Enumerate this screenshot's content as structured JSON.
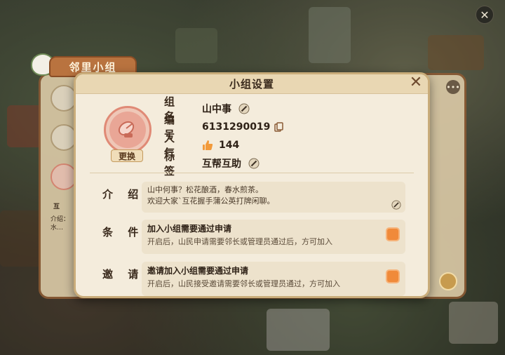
{
  "background_panel": {
    "tab_title": "邻里小组",
    "list_snippet_prefix": "介绍：",
    "list_snippet_prefix2": "水…",
    "list_snippet_tag": "互"
  },
  "modal": {
    "title": "小组设置",
    "avatar_button": "更换",
    "group_name_label": "组 名",
    "group_name": "山中事",
    "group_id_label": "编 号",
    "group_id": "6131290019",
    "popularity_label": "人 气",
    "popularity": "144",
    "tag_label": "标 签",
    "tag": "互帮互助",
    "intro_label": "介 绍",
    "intro_line1": "山中何事？松花酿酒，春水煎茶。",
    "intro_line2": "欢迎大家`互花握手蒲公英打牌闲聊。",
    "condition_label": "条 件",
    "condition_title": "加入小组需要通过申请",
    "condition_desc": "开启后，山民申请需要邻长或管理员通过后，方可加入",
    "invite_label": "邀 请",
    "invite_title": "邀请加入小组需要通过申请",
    "invite_desc": "开启后，山民接受邀请需要邻长或管理员通过，方可加入"
  },
  "colors": {
    "accent_orange": "#f08a3a",
    "header_bg": "#e9d7b3",
    "panel_bg": "#f4ecdc",
    "tab_brown": "#b9733f"
  },
  "icons": [
    "close-icon",
    "edit-icon",
    "copy-icon",
    "thumb-up-icon",
    "satellite-dish-icon",
    "more-icon"
  ]
}
